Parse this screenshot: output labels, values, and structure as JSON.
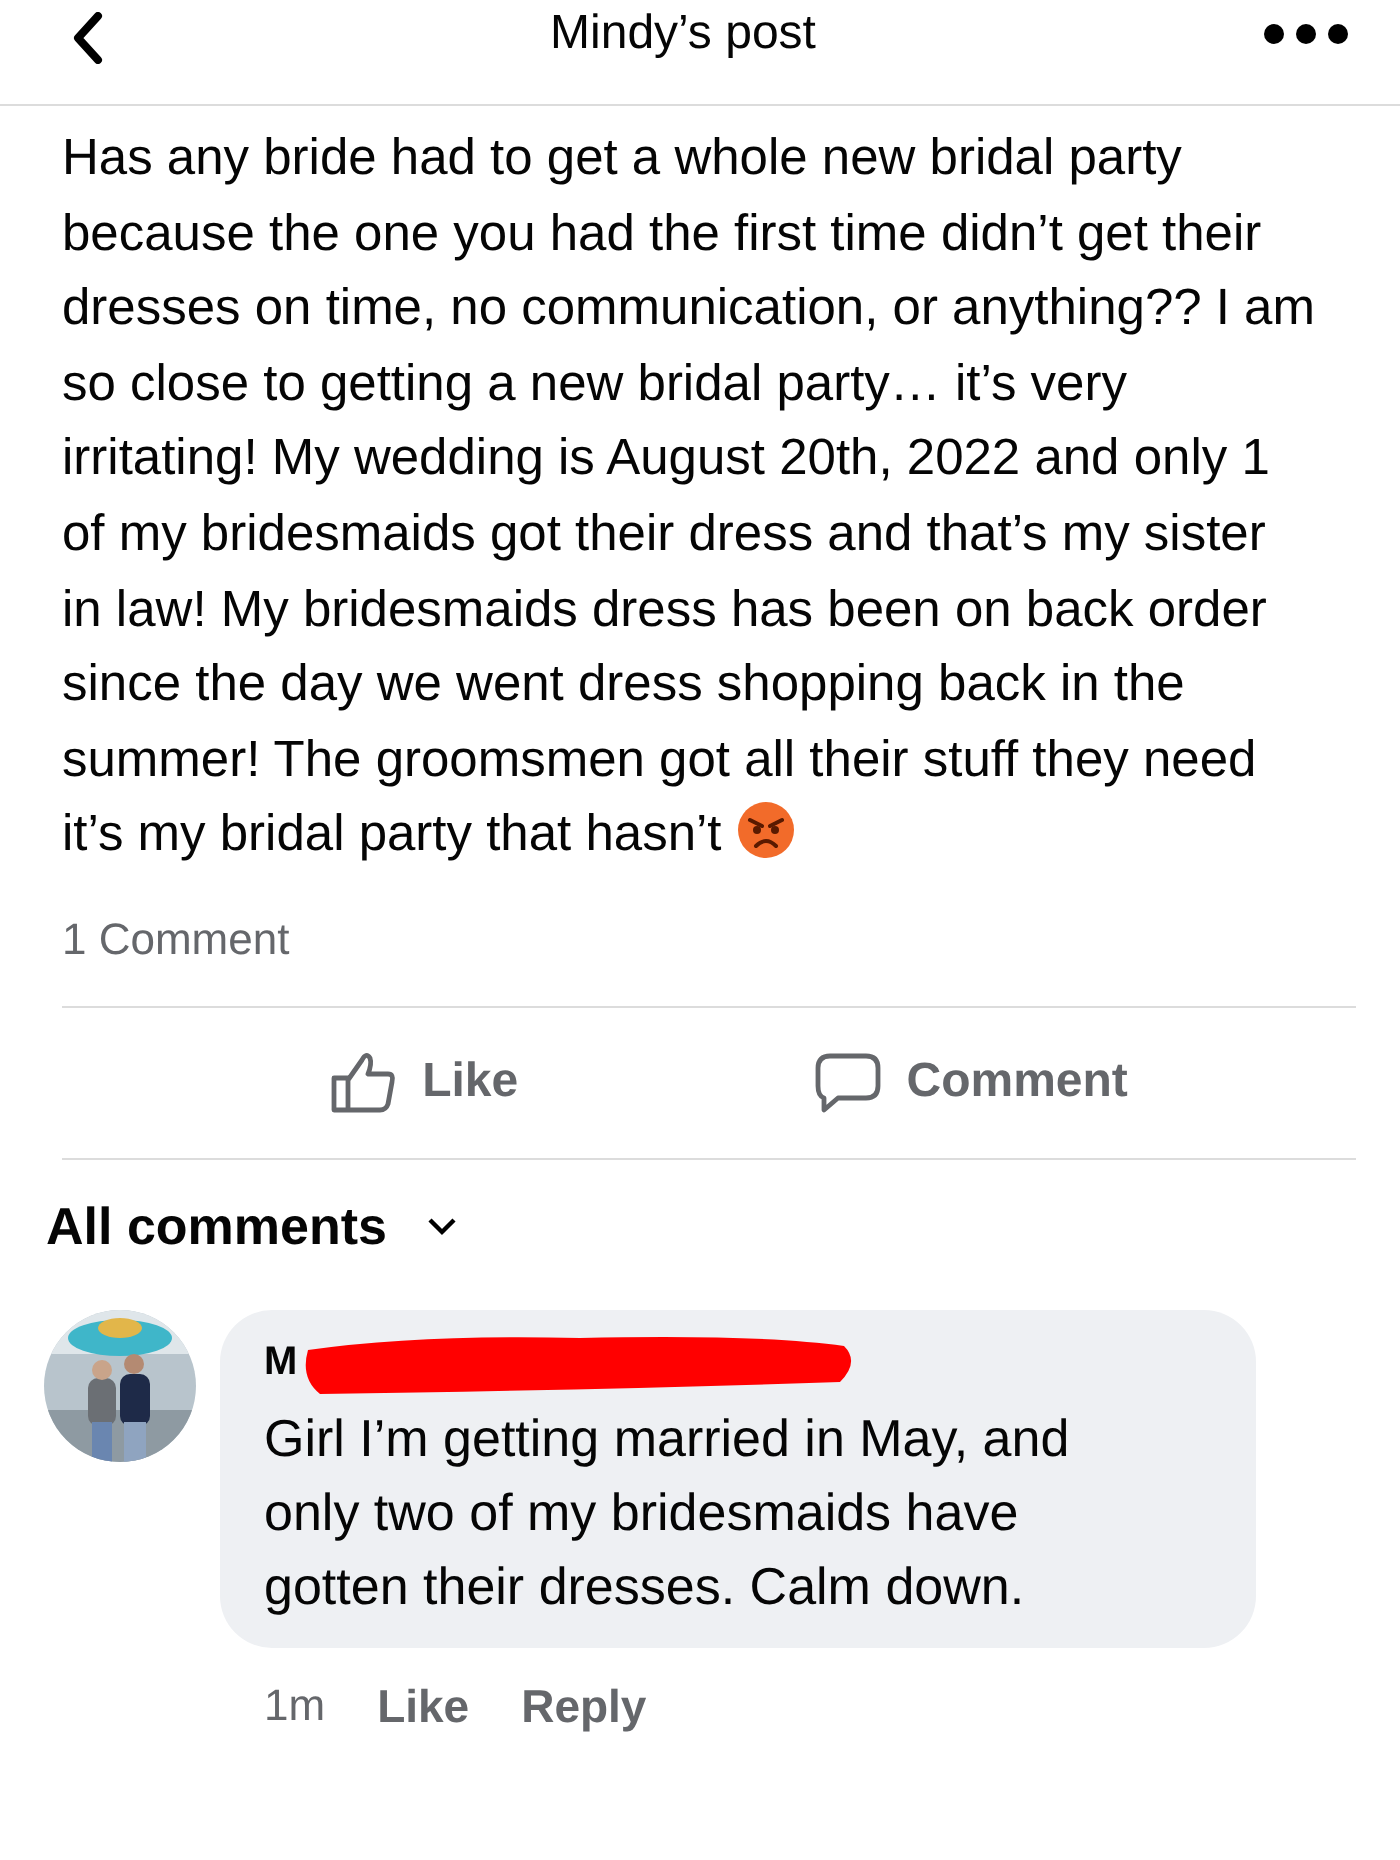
{
  "header": {
    "title": "Mindy’s post"
  },
  "post": {
    "text": "Has any bride had to get a whole new bridal party because the one you had the first time didn’t get their dresses on time, no communication, or anything?? I am so close to getting a new bridal party… it’s very irritating! My wedding is August 20th, 2022 and only 1 of my bridesmaids got their dress and that’s my sister in law! My bridesmaids dress has been on back order since the day we went dress shopping back in the summer! The groomsmen got all their stuff they need it’s my bridal party that hasn’t",
    "comment_count": "1 Comment"
  },
  "actions": [
    {
      "kind": "like",
      "label": "Like"
    },
    {
      "kind": "comment",
      "label": "Comment"
    }
  ],
  "comments_header": "All comments",
  "comments": [
    {
      "author": "M",
      "text": "Girl I’m getting married in May, and only two of my bridesmaids have gotten their dresses. Calm down.",
      "time": "1m",
      "like": "Like",
      "reply": "Reply"
    }
  ]
}
